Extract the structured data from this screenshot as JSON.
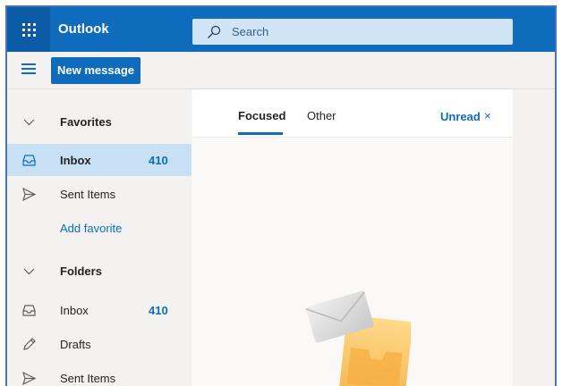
{
  "header": {
    "app_title": "Outlook",
    "search_placeholder": "Search",
    "brand_color": "#0f6cbd"
  },
  "command_bar": {
    "new_message_label": "New message"
  },
  "folder_pane": {
    "favorites": {
      "label": "Favorites",
      "items": [
        {
          "label": "Inbox",
          "count": "410",
          "icon": "inbox-icon",
          "selected": true
        },
        {
          "label": "Sent Items",
          "count": "",
          "icon": "send-icon",
          "selected": false
        }
      ],
      "add_favorite_label": "Add favorite"
    },
    "folders": {
      "label": "Folders",
      "items": [
        {
          "label": "Inbox",
          "count": "410",
          "icon": "inbox-icon"
        },
        {
          "label": "Drafts",
          "count": "",
          "icon": "pencil-icon"
        },
        {
          "label": "Sent Items",
          "count": "",
          "icon": "send-icon"
        }
      ]
    }
  },
  "message_list": {
    "tabs": [
      {
        "label": "Focused",
        "active": true
      },
      {
        "label": "Other",
        "active": false
      }
    ],
    "filter_label": "Unread",
    "filter_close_glyph": "×"
  }
}
